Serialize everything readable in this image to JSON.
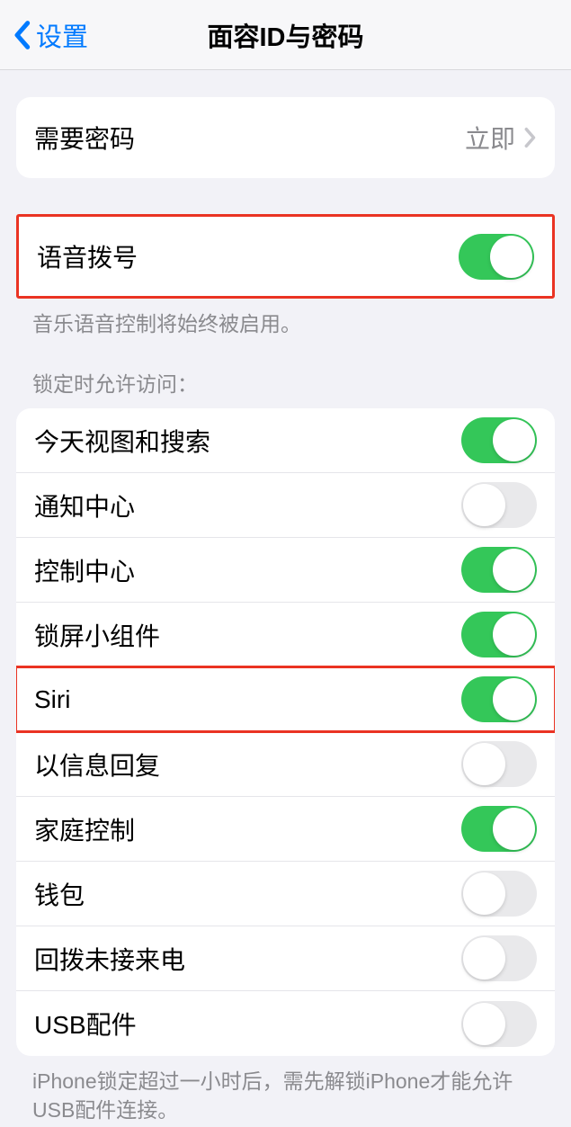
{
  "header": {
    "back_label": "设置",
    "title": "面容ID与密码"
  },
  "require_passcode": {
    "label": "需要密码",
    "value": "立即"
  },
  "voice_dial": {
    "label": "语音拨号",
    "on": true,
    "footer": "音乐语音控制将始终被启用。"
  },
  "allow_access": {
    "header": "锁定时允许访问：",
    "items": [
      {
        "label": "今天视图和搜索",
        "on": true
      },
      {
        "label": "通知中心",
        "on": false
      },
      {
        "label": "控制中心",
        "on": true
      },
      {
        "label": "锁屏小组件",
        "on": true
      },
      {
        "label": "Siri",
        "on": true
      },
      {
        "label": "以信息回复",
        "on": false
      },
      {
        "label": "家庭控制",
        "on": true
      },
      {
        "label": "钱包",
        "on": false
      },
      {
        "label": "回拨未接来电",
        "on": false
      },
      {
        "label": "USB配件",
        "on": false
      }
    ],
    "footer": "iPhone锁定超过一小时后，需先解锁iPhone才能允许USB配件连接。"
  }
}
